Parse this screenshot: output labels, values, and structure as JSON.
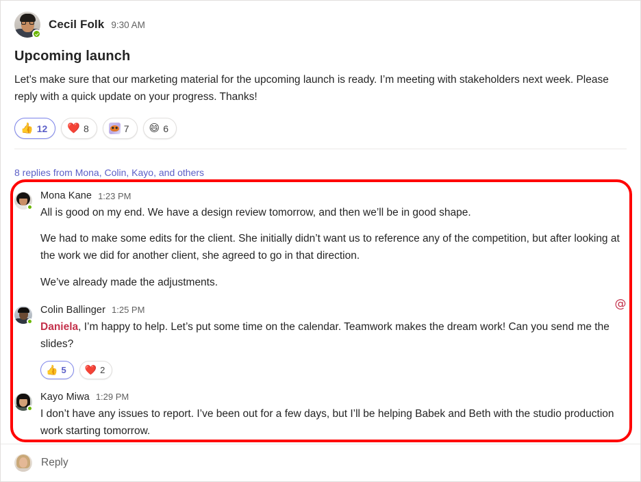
{
  "root_message": {
    "author": "Cecil Folk",
    "time": "9:30 AM",
    "subject": "Upcoming launch",
    "body": "Let’s make sure that our marketing material for the upcoming launch is ready. I’m meeting with stakeholders next week. Please reply with a quick update on your progress. Thanks!",
    "presence": "available",
    "reactions": [
      {
        "icon": "thumbs-up-emoji",
        "glyph": "👍",
        "count": "12",
        "selected": true
      },
      {
        "icon": "heart-emoji",
        "glyph": "❤️",
        "count": "8",
        "selected": false
      },
      {
        "icon": "custom-emoji",
        "glyph": "",
        "count": "7",
        "selected": false
      },
      {
        "icon": "laughing-emoji",
        "glyph": "😄",
        "count": "6",
        "selected": false
      }
    ]
  },
  "replies_summary": {
    "label": "8 replies from Mona, Colin, Kayo, and others",
    "count": "8"
  },
  "replies": [
    {
      "author": "Mona Kane",
      "time": "1:23 PM",
      "presence": "available",
      "paragraphs": [
        "All is good on my end. We have a design review tomorrow, and then we’ll be in good shape.",
        "We had to make some edits for the client. She initially didn’t want us to reference any of the competition, but after looking at the work we did for another client, she agreed to go in that direction.",
        "We’ve already made the adjustments."
      ],
      "mention": "",
      "text_after_mention": "",
      "has_at_icon": false,
      "reactions": []
    },
    {
      "author": "Colin Ballinger",
      "time": "1:25 PM",
      "presence": "available",
      "paragraphs": [],
      "mention": "Daniela",
      "text_after_mention": ", I’m happy to help. Let’s put some time on the calendar. Teamwork makes the dream work! Can you send me the slides?",
      "has_at_icon": true,
      "at_icon": "at-mention-icon",
      "reactions": [
        {
          "icon": "thumbs-up-emoji",
          "glyph": "👍",
          "count": "5",
          "selected": true
        },
        {
          "icon": "heart-emoji",
          "glyph": "❤️",
          "count": "2",
          "selected": false
        }
      ]
    },
    {
      "author": "Kayo Miwa",
      "time": "1:29 PM",
      "presence": "available",
      "paragraphs": [
        "I don’t have any issues to report. I’ve been out for a few days, but I’ll be helping Babek and Beth with the studio production work starting tomorrow."
      ],
      "mention": "",
      "text_after_mention": "",
      "has_at_icon": false,
      "reactions": []
    }
  ],
  "compose": {
    "placeholder": "Reply"
  },
  "colors": {
    "accent": "#5b5fc7",
    "mention": "#c4314b",
    "highlight": "#ff0000",
    "presence_available": "#6bb700",
    "text_primary": "#242424",
    "text_secondary": "#616161",
    "pill_border_selected": "#7b83eb"
  }
}
